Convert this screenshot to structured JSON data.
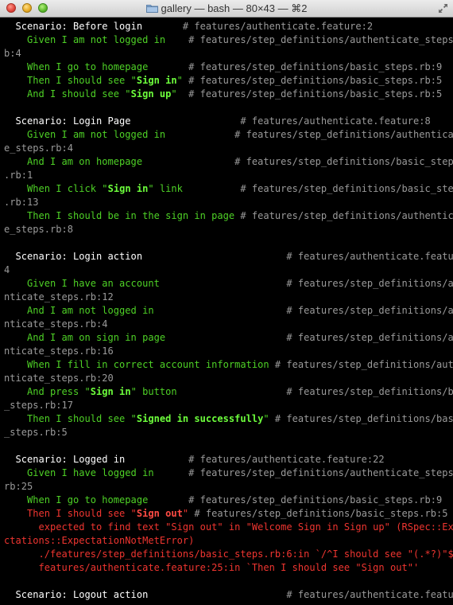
{
  "window": {
    "title": "gallery — bash — 80×43 — ⌘2",
    "icons": {
      "folder": "folder-icon",
      "fullscreen": "fullscreen-arrows-icon"
    },
    "traffic_lights": [
      "close",
      "minimize",
      "zoom"
    ]
  },
  "colors": {
    "background": "#000000",
    "text": "#ffffff",
    "comment": "#9a9a9a",
    "passed": "#4ed126",
    "failed": "#ef3530"
  },
  "terminal": {
    "lines": [
      {
        "segs": [
          {
            "c": "w",
            "t": "  Scenario: Before login       "
          },
          {
            "c": "c",
            "t": "# features/authenticate.feature:2"
          }
        ]
      },
      {
        "segs": [
          {
            "c": "g",
            "t": "    Given I am not logged in    "
          },
          {
            "c": "c",
            "t": "# features/step_definitions/authenticate_steps.r"
          }
        ]
      },
      {
        "segs": [
          {
            "c": "c",
            "t": "b:4"
          }
        ]
      },
      {
        "segs": [
          {
            "c": "g",
            "t": "    When I go to homepage       "
          },
          {
            "c": "c",
            "t": "# features/step_definitions/basic_steps.rb:9"
          }
        ]
      },
      {
        "segs": [
          {
            "c": "g",
            "t": "    Then I should see \""
          },
          {
            "c": "gb",
            "t": "Sign in"
          },
          {
            "c": "g",
            "t": "\" "
          },
          {
            "c": "c",
            "t": "# features/step_definitions/basic_steps.rb:5"
          }
        ]
      },
      {
        "segs": [
          {
            "c": "g",
            "t": "    And I should see \""
          },
          {
            "c": "gb",
            "t": "Sign up"
          },
          {
            "c": "g",
            "t": "\"  "
          },
          {
            "c": "c",
            "t": "# features/step_definitions/basic_steps.rb:5"
          }
        ]
      },
      {
        "segs": [
          {
            "c": "w",
            "t": ""
          }
        ]
      },
      {
        "segs": [
          {
            "c": "w",
            "t": "  Scenario: Login Page                   "
          },
          {
            "c": "c",
            "t": "# features/authenticate.feature:8"
          }
        ]
      },
      {
        "segs": [
          {
            "c": "g",
            "t": "    Given I am not logged in            "
          },
          {
            "c": "c",
            "t": "# features/step_definitions/authenticat"
          }
        ]
      },
      {
        "segs": [
          {
            "c": "c",
            "t": "e_steps.rb:4"
          }
        ]
      },
      {
        "segs": [
          {
            "c": "g",
            "t": "    And I am on homepage                "
          },
          {
            "c": "c",
            "t": "# features/step_definitions/basic_steps"
          }
        ]
      },
      {
        "segs": [
          {
            "c": "c",
            "t": ".rb:1"
          }
        ]
      },
      {
        "segs": [
          {
            "c": "g",
            "t": "    When I click \""
          },
          {
            "c": "gb",
            "t": "Sign in"
          },
          {
            "c": "g",
            "t": "\" link          "
          },
          {
            "c": "c",
            "t": "# features/step_definitions/basic_steps"
          }
        ]
      },
      {
        "segs": [
          {
            "c": "c",
            "t": ".rb:13"
          }
        ]
      },
      {
        "segs": [
          {
            "c": "g",
            "t": "    Then I should be in the sign in page "
          },
          {
            "c": "c",
            "t": "# features/step_definitions/authenticat"
          }
        ]
      },
      {
        "segs": [
          {
            "c": "c",
            "t": "e_steps.rb:8"
          }
        ]
      },
      {
        "segs": [
          {
            "c": "w",
            "t": ""
          }
        ]
      },
      {
        "segs": [
          {
            "c": "w",
            "t": "  Scenario: Login action                         "
          },
          {
            "c": "c",
            "t": "# features/authenticate.feature:1"
          }
        ]
      },
      {
        "segs": [
          {
            "c": "c",
            "t": "4"
          }
        ]
      },
      {
        "segs": [
          {
            "c": "g",
            "t": "    Given I have an account                      "
          },
          {
            "c": "c",
            "t": "# features/step_definitions/authe"
          }
        ]
      },
      {
        "segs": [
          {
            "c": "c",
            "t": "nticate_steps.rb:12"
          }
        ]
      },
      {
        "segs": [
          {
            "c": "g",
            "t": "    And I am not logged in                       "
          },
          {
            "c": "c",
            "t": "# features/step_definitions/authe"
          }
        ]
      },
      {
        "segs": [
          {
            "c": "c",
            "t": "nticate_steps.rb:4"
          }
        ]
      },
      {
        "segs": [
          {
            "c": "g",
            "t": "    And I am on sign in page                     "
          },
          {
            "c": "c",
            "t": "# features/step_definitions/authe"
          }
        ]
      },
      {
        "segs": [
          {
            "c": "c",
            "t": "nticate_steps.rb:16"
          }
        ]
      },
      {
        "segs": [
          {
            "c": "g",
            "t": "    When I fill in correct account information "
          },
          {
            "c": "c",
            "t": "# features/step_definitions/authe"
          }
        ]
      },
      {
        "segs": [
          {
            "c": "c",
            "t": "nticate_steps.rb:20"
          }
        ]
      },
      {
        "segs": [
          {
            "c": "g",
            "t": "    And press \""
          },
          {
            "c": "gb",
            "t": "Sign in"
          },
          {
            "c": "g",
            "t": "\" button                   "
          },
          {
            "c": "c",
            "t": "# features/step_definitions/basic"
          }
        ]
      },
      {
        "segs": [
          {
            "c": "c",
            "t": "_steps.rb:17"
          }
        ]
      },
      {
        "segs": [
          {
            "c": "g",
            "t": "    Then I should see \""
          },
          {
            "c": "gb",
            "t": "Signed in successfully"
          },
          {
            "c": "g",
            "t": "\" "
          },
          {
            "c": "c",
            "t": "# features/step_definitions/basic"
          }
        ]
      },
      {
        "segs": [
          {
            "c": "c",
            "t": "_steps.rb:5"
          }
        ]
      },
      {
        "segs": [
          {
            "c": "w",
            "t": ""
          }
        ]
      },
      {
        "segs": [
          {
            "c": "w",
            "t": "  Scenario: Logged in           "
          },
          {
            "c": "c",
            "t": "# features/authenticate.feature:22"
          }
        ]
      },
      {
        "segs": [
          {
            "c": "g",
            "t": "    Given I have logged in      "
          },
          {
            "c": "c",
            "t": "# features/step_definitions/authenticate_steps."
          }
        ]
      },
      {
        "segs": [
          {
            "c": "c",
            "t": "rb:25"
          }
        ]
      },
      {
        "segs": [
          {
            "c": "g",
            "t": "    When I go to homepage       "
          },
          {
            "c": "c",
            "t": "# features/step_definitions/basic_steps.rb:9"
          }
        ]
      },
      {
        "segs": [
          {
            "c": "r",
            "t": "    Then I should see \""
          },
          {
            "c": "rb",
            "t": "Sign out"
          },
          {
            "c": "r",
            "t": "\" "
          },
          {
            "c": "c",
            "t": "# features/step_definitions/basic_steps.rb:5"
          }
        ]
      },
      {
        "segs": [
          {
            "c": "r",
            "t": "      expected to find text \"Sign out\" in \"Welcome Sign in Sign up\" (RSpec::Expe"
          }
        ]
      },
      {
        "segs": [
          {
            "c": "r",
            "t": "ctations::ExpectationNotMetError)"
          }
        ]
      },
      {
        "segs": [
          {
            "c": "r",
            "t": "      ./features/step_definitions/basic_steps.rb:6:in `/^I should see \"(.*?)\"$/'"
          }
        ]
      },
      {
        "segs": [
          {
            "c": "r",
            "t": "      features/authenticate.feature:25:in `Then I should see \"Sign out\"'"
          }
        ]
      },
      {
        "segs": [
          {
            "c": "w",
            "t": ""
          }
        ]
      },
      {
        "segs": [
          {
            "c": "w",
            "t": "  Scenario: Logout action                        "
          },
          {
            "c": "c",
            "t": "# features/authenticate.feature:2"
          }
        ]
      }
    ]
  }
}
